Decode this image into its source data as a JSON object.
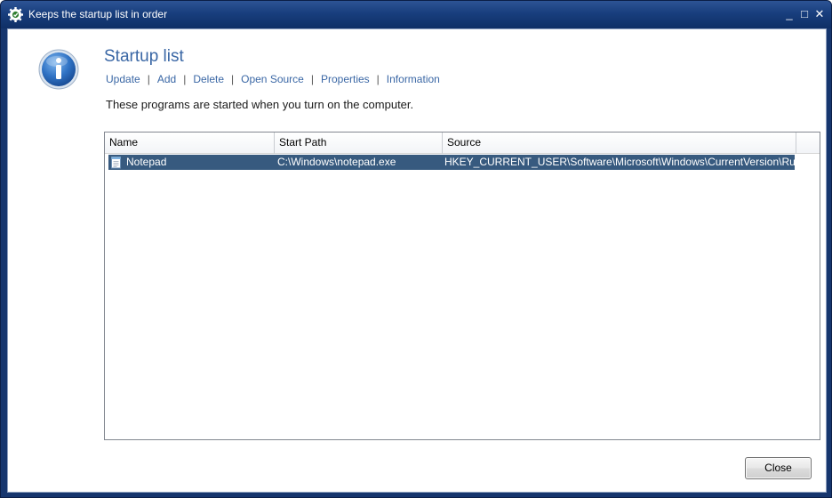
{
  "window": {
    "title": "Keeps the startup list in order",
    "controls": {
      "minimize": "_",
      "maximize": "□",
      "close": "✕"
    }
  },
  "header": {
    "heading": "Startup list",
    "icon": "info-icon"
  },
  "toolbar": {
    "items": [
      "Update",
      "Add",
      "Delete",
      "Open Source",
      "Properties",
      "Information"
    ],
    "separator": "|"
  },
  "description": "These programs are started when you turn on the computer.",
  "list": {
    "columns": [
      "Name",
      "Start Path",
      "Source"
    ],
    "rows": [
      {
        "name": "Notepad",
        "start_path": "C:\\Windows\\notepad.exe",
        "source": "HKEY_CURRENT_USER\\Software\\Microsoft\\Windows\\CurrentVersion\\Run",
        "icon": "notepad-icon",
        "selected": true
      }
    ]
  },
  "footer": {
    "close_label": "Close"
  },
  "colors": {
    "title_bar": "#183e7d",
    "heading": "#3a67a5",
    "selection": "#375a7f"
  }
}
